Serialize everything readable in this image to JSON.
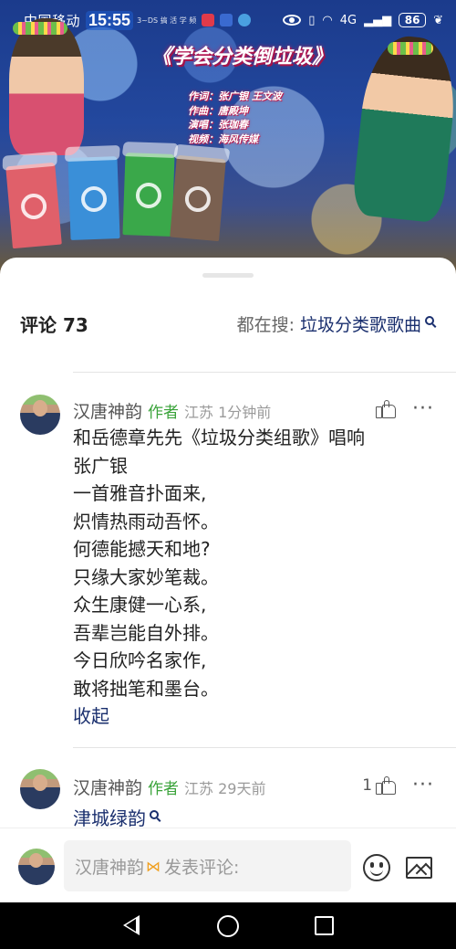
{
  "status_bar": {
    "carrier": "中国移动",
    "time": "15:55",
    "app_tag": "3~DS 搞 活 学 频",
    "network": "4G",
    "battery": "86"
  },
  "video": {
    "title": "《学会分类倒垃圾》",
    "credits": [
      "作词：张广银 王文波",
      "作曲：唐殿坤",
      "演唱：张珈春",
      "视频：海风传媒"
    ],
    "bin_colors": [
      "#e0606a",
      "#3a8fd8",
      "#3aa84a",
      "#7a6050"
    ]
  },
  "header": {
    "comments_label": "评论 73",
    "search_prefix": "都在搜:",
    "search_keyword": "垃圾分类歌歌曲"
  },
  "comments": [
    {
      "name": "汉唐神韵",
      "badge": "作者",
      "location_time": "江苏 1分钟前",
      "like_count": "",
      "lines": [
        "和岳德章先先《垃圾分类组歌》唱响",
        "张广银",
        "一首雅音扑面来,",
        "炽情热雨动吾怀。",
        "何德能撼天和地?",
        "只缘大家妙笔裁。",
        "众生康健一心系,",
        "吾辈岂能自外排。",
        "今日欣吟名家作,",
        "敢将拙笔和墨台。"
      ],
      "collapse_label": "收起"
    },
    {
      "name": "汉唐神韵",
      "badge": "作者",
      "location_time": "江苏 29天前",
      "like_count": "1",
      "reply_text": "津城绿韵"
    }
  ],
  "input_bar": {
    "user_name": "汉唐神韵",
    "placeholder": "发表评论:"
  }
}
